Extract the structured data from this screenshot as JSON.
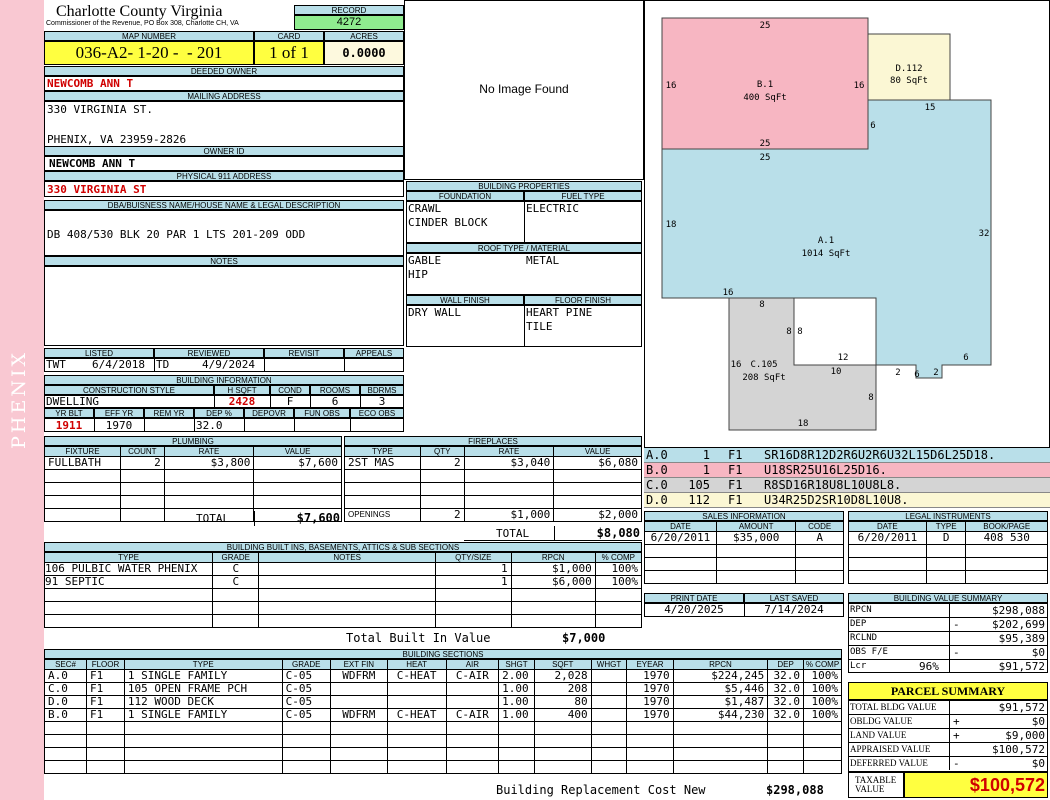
{
  "sidebar_label": "PHENIX",
  "county": {
    "name": "Charlotte County Virginia",
    "address": "Commissioner of the Revenue, PO Box 308, Charlotte CH, VA"
  },
  "record": {
    "label": "RECORD",
    "value": "4272"
  },
  "map": {
    "label": "MAP NUMBER",
    "value": "036-A2- 1-20 -  - 201",
    "card_label": "CARD",
    "card": "1 of 1",
    "acres_label": "ACRES",
    "acres": "0.0000"
  },
  "deeded_owner": {
    "label": "DEEDED OWNER",
    "value": "NEWCOMB ANN T"
  },
  "mailing": {
    "label": "MAILING ADDRESS",
    "line1": "330 VIRGINIA ST.",
    "line2": "PHENIX, VA 23959-2826"
  },
  "owner_id": {
    "label": "OWNER ID",
    "value": "NEWCOMB ANN T"
  },
  "physical": {
    "label": "PHYSICAL 911 ADDRESS",
    "value": "330 VIRGINIA ST"
  },
  "dba": {
    "label": "DBA/BUISNESS NAME/HOUSE NAME & LEGAL DESCRIPTION",
    "value": "DB 408/530 BLK 20 PAR 1 LTS 201-209 ODD"
  },
  "notes": {
    "label": "NOTES"
  },
  "listing": {
    "listed_label": "LISTED",
    "reviewed_label": "REVIEWED",
    "revisit_label": "REVISIT",
    "appeals_label": "APPEALS",
    "listed_by": "TWT",
    "listed_date": "6/4/2018",
    "reviewed_by": "TD",
    "reviewed_date": "4/9/2024"
  },
  "building_info": {
    "label": "BUILDING INFORMATION",
    "h1": [
      "CONSTRUCTION STYLE",
      "H SQFT",
      "COND",
      "ROOMS",
      "BDRMS"
    ],
    "v1": [
      "DWELLING",
      "2428",
      "F",
      "6",
      "3"
    ],
    "h2": [
      "YR BLT",
      "EFF YR",
      "REM YR",
      "DEP %",
      "DEPOVR",
      "FUN OBS",
      "ECO OBS"
    ],
    "v2": [
      "1911",
      "1970",
      "",
      "32.0",
      "",
      "",
      ""
    ]
  },
  "image": {
    "text": "No Image Found"
  },
  "building_props": {
    "label": "BUILDING PROPERTIES",
    "foundation_label": "FOUNDATION",
    "fuel_label": "FUEL TYPE",
    "foundation": [
      "CRAWL",
      "CINDER BLOCK"
    ],
    "fuel": [
      "ELECTRIC"
    ],
    "roof_label": "ROOF TYPE / MATERIAL",
    "roof_type": [
      "GABLE",
      "HIP"
    ],
    "roof_material": [
      "METAL"
    ],
    "wall_label": "WALL FINISH",
    "floor_label": "FLOOR FINISH",
    "wall": [
      "DRY WALL"
    ],
    "floor": [
      "HEART PINE",
      "TILE"
    ]
  },
  "sketch": {
    "areas": [
      {
        "id": "B.1",
        "label": "B.1",
        "sqft": "400 SqFt"
      },
      {
        "id": "D.112",
        "label": "D.112",
        "sqft": "80 SqFt"
      },
      {
        "id": "A.1",
        "label": "A.1",
        "sqft": "1014 SqFt"
      },
      {
        "id": "C.105",
        "label": "C.105",
        "sqft": "208 SqFt"
      }
    ],
    "dims": [
      "25",
      "16",
      "16",
      "25",
      "25",
      "15",
      "6",
      "18",
      "32",
      "16",
      "8",
      "8",
      "8",
      "12",
      "10",
      "2",
      "6",
      "2",
      "6",
      "16",
      "8",
      "18"
    ]
  },
  "sketch_codes": [
    {
      "sec": "A.0",
      "n": "1",
      "fl": "F1",
      "code": "SR16D8R12D2R6U2R6U32L15D6L25D18.",
      "color": "#b9dfe9"
    },
    {
      "sec": "B.0",
      "n": "1",
      "fl": "F1",
      "code": "U18SR25U16L25D16.",
      "color": "#f7b6c2"
    },
    {
      "sec": "C.0",
      "n": "105",
      "fl": "F1",
      "code": "R8SD16R18U8L10U8L8.",
      "color": "#d4d4d4"
    },
    {
      "sec": "D.0",
      "n": "112",
      "fl": "F1",
      "code": "U34R25D2SR10D8L10U8.",
      "color": "#fbf7d4"
    }
  ],
  "plumbing": {
    "label": "PLUMBING",
    "headers": [
      "FIXTURE",
      "COUNT",
      "RATE",
      "VALUE"
    ],
    "rows": [
      [
        "FULLBATH",
        "2",
        "$3,800",
        "$7,600"
      ],
      [
        "",
        "",
        "",
        ""
      ],
      [
        "",
        "",
        "",
        ""
      ],
      [
        "",
        "",
        "",
        ""
      ],
      [
        "",
        "",
        "",
        ""
      ]
    ],
    "total_label": "TOTAL",
    "total": "$7,600"
  },
  "fireplaces": {
    "label": "FIREPLACES",
    "headers": [
      "TYPE",
      "QTY",
      "RATE",
      "VALUE"
    ],
    "rows": [
      [
        "2ST MAS",
        "2",
        "$3,040",
        "$6,080"
      ],
      [
        "",
        "",
        "",
        ""
      ],
      [
        "",
        "",
        "",
        ""
      ],
      [
        "",
        "",
        "",
        ""
      ]
    ],
    "openings_label": "OPENINGS",
    "openings_qty": "2",
    "openings_rate": "$1,000",
    "openings_value": "$2,000",
    "total_label": "TOTAL",
    "total": "$8,080"
  },
  "sales": {
    "label": "SALES INFORMATION",
    "headers": [
      "DATE",
      "AMOUNT",
      "CODE"
    ],
    "rows": [
      [
        "6/20/2011",
        "$35,000",
        "A"
      ]
    ]
  },
  "legal": {
    "label": "LEGAL INSTRUMENTS",
    "headers": [
      "DATE",
      "TYPE",
      "BOOK/PAGE"
    ],
    "rows": [
      [
        "6/20/2011",
        "D",
        "408 530"
      ]
    ]
  },
  "builtins": {
    "label": "BUILDING BUILT INS, BASEMENTS, ATTICS & SUB SECTIONS",
    "headers": [
      "TYPE",
      "GRADE",
      "NOTES",
      "QTY/SIZE",
      "RPCN",
      "% COMP"
    ],
    "rows": [
      [
        "106 PULBIC WATER PHENIX",
        "C",
        "",
        "1",
        "$1,000",
        "100%"
      ],
      [
        "91 SEPTIC",
        "C",
        "",
        "1",
        "$6,000",
        "100%"
      ]
    ],
    "total_label": "Total Built In Value",
    "total": "$7,000"
  },
  "print": {
    "print_label": "PRINT DATE",
    "saved_label": "LAST SAVED",
    "print_date": "4/20/2025",
    "last_saved": "7/14/2024"
  },
  "value_summary": {
    "label": "BUILDING VALUE SUMMARY",
    "rows": [
      {
        "label": "RPCN",
        "sign": "",
        "value": "$298,088"
      },
      {
        "label": "DEP",
        "sign": "-",
        "value": "$202,699"
      },
      {
        "label": "RCLND",
        "sign": "",
        "value": "$95,389"
      },
      {
        "label": "OBS F/E",
        "sign": "-",
        "value": "$0"
      },
      {
        "label": "Lcr",
        "sign": "96%",
        "value": "$91,572"
      }
    ]
  },
  "parcel": {
    "label": "PARCEL SUMMARY",
    "rows": [
      {
        "label": "TOTAL BLDG VALUE",
        "sign": "",
        "value": "$91,572"
      },
      {
        "label": "OBLDG VALUE",
        "sign": "+",
        "value": "$0"
      },
      {
        "label": "LAND VALUE",
        "sign": "+",
        "value": "$9,000"
      },
      {
        "label": "APPRAISED VALUE",
        "sign": "",
        "value": "$100,572"
      },
      {
        "label": "DEFERRED VALUE",
        "sign": "-",
        "value": "$0"
      }
    ],
    "taxable_label": "TAXABLE VALUE",
    "taxable": "$100,572"
  },
  "sections": {
    "label": "BUILDING SECTIONS",
    "headers": [
      "SEC#",
      "FLOOR",
      "TYPE",
      "GRADE",
      "EXT FIN",
      "HEAT",
      "AIR",
      "SHGT",
      "SQFT",
      "WHGT",
      "EYEAR",
      "RPCN",
      "DEP",
      "% COMP"
    ],
    "rows": [
      [
        "A.0",
        "F1",
        "1 SINGLE FAMILY",
        "C-05",
        "WDFRM",
        "C-HEAT",
        "C-AIR",
        "2.00",
        "2,028",
        "",
        "1970",
        "$224,245",
        "32.0",
        "100%"
      ],
      [
        "C.0",
        "F1",
        "105 OPEN FRAME PCH",
        "C-05",
        "",
        "",
        "",
        "1.00",
        "208",
        "",
        "1970",
        "$5,446",
        "32.0",
        "100%"
      ],
      [
        "D.0",
        "F1",
        "112 WOOD DECK",
        "C-05",
        "",
        "",
        "",
        "1.00",
        "80",
        "",
        "1970",
        "$1,487",
        "32.0",
        "100%"
      ],
      [
        "B.0",
        "F1",
        "1 SINGLE FAMILY",
        "C-05",
        "WDFRM",
        "C-HEAT",
        "C-AIR",
        "1.00",
        "400",
        "",
        "1970",
        "$44,230",
        "32.0",
        "100%"
      ]
    ],
    "total_label": "Building Replacement Cost New",
    "total": "$298,088"
  }
}
